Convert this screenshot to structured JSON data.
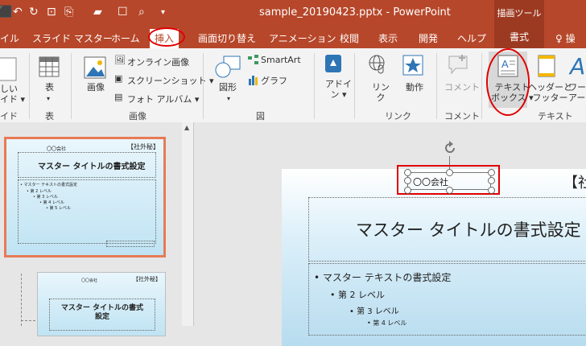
{
  "titlebar": {
    "doc_title": "sample_20190423.pptx - PowerPoint",
    "context_header": "描画ツール",
    "qat": [
      "⬛",
      "↶",
      "↻",
      "⊡",
      "🖌",
      "🗁",
      "☐",
      "🔍",
      "▾"
    ]
  },
  "tabs": [
    "イル",
    "スライド マスター",
    "ホーム",
    "挿入",
    "画面切り替え",
    "アニメーション",
    "校閲",
    "表示",
    "開発",
    "ヘルプ",
    "書式",
    "♀ 操"
  ],
  "ribbon": {
    "new_slide": "しい\nイド ▾",
    "table": "表",
    "image": "画像",
    "online_image": "オンライン画像",
    "screenshot": "スクリーンショット ▾",
    "photo_album": "フォト アルバム ▾",
    "shapes": "図形",
    "smartart": "SmartArt",
    "graph": "グラフ",
    "addin": "アドイ\nン ▾",
    "link": "リン\nク",
    "action": "動作",
    "comment": "コメント",
    "textbox": "テキスト\nボックス ▾",
    "header_footer": "ヘッダーと\nフッター",
    "wordart": "ワー\nアート",
    "groups": {
      "slide": "イド",
      "table": "表",
      "image": "画像",
      "figure": "図",
      "link": "リンク",
      "comment": "コメント",
      "text": "テキスト"
    }
  },
  "thumb1": {
    "company": "〇〇会社",
    "confidential": "【社外秘】",
    "title": "マスター タイトルの書式設定",
    "bullets": [
      "• マスター テキストの書式設定",
      "• 第 2 レベル",
      "• 第 3 レベル",
      "• 第 4 レベル",
      "• 第 5 レベル"
    ]
  },
  "thumb2": {
    "company": "〇〇会社",
    "confidential": "【社外秘】",
    "title": "マスター タイトルの書式\n設定"
  },
  "slide": {
    "company": "〇〇会社",
    "confidential": "【社",
    "title": "マスター タイトルの書式設定",
    "bullet1": "• マスター テキストの書式設定",
    "bullet2": "• 第 2 レベル",
    "bullet3": "• 第 3 レベル",
    "bullet4": "• 第 4 レベル"
  },
  "colors": {
    "accent": "#b7472a",
    "highlight": "#e00000"
  }
}
